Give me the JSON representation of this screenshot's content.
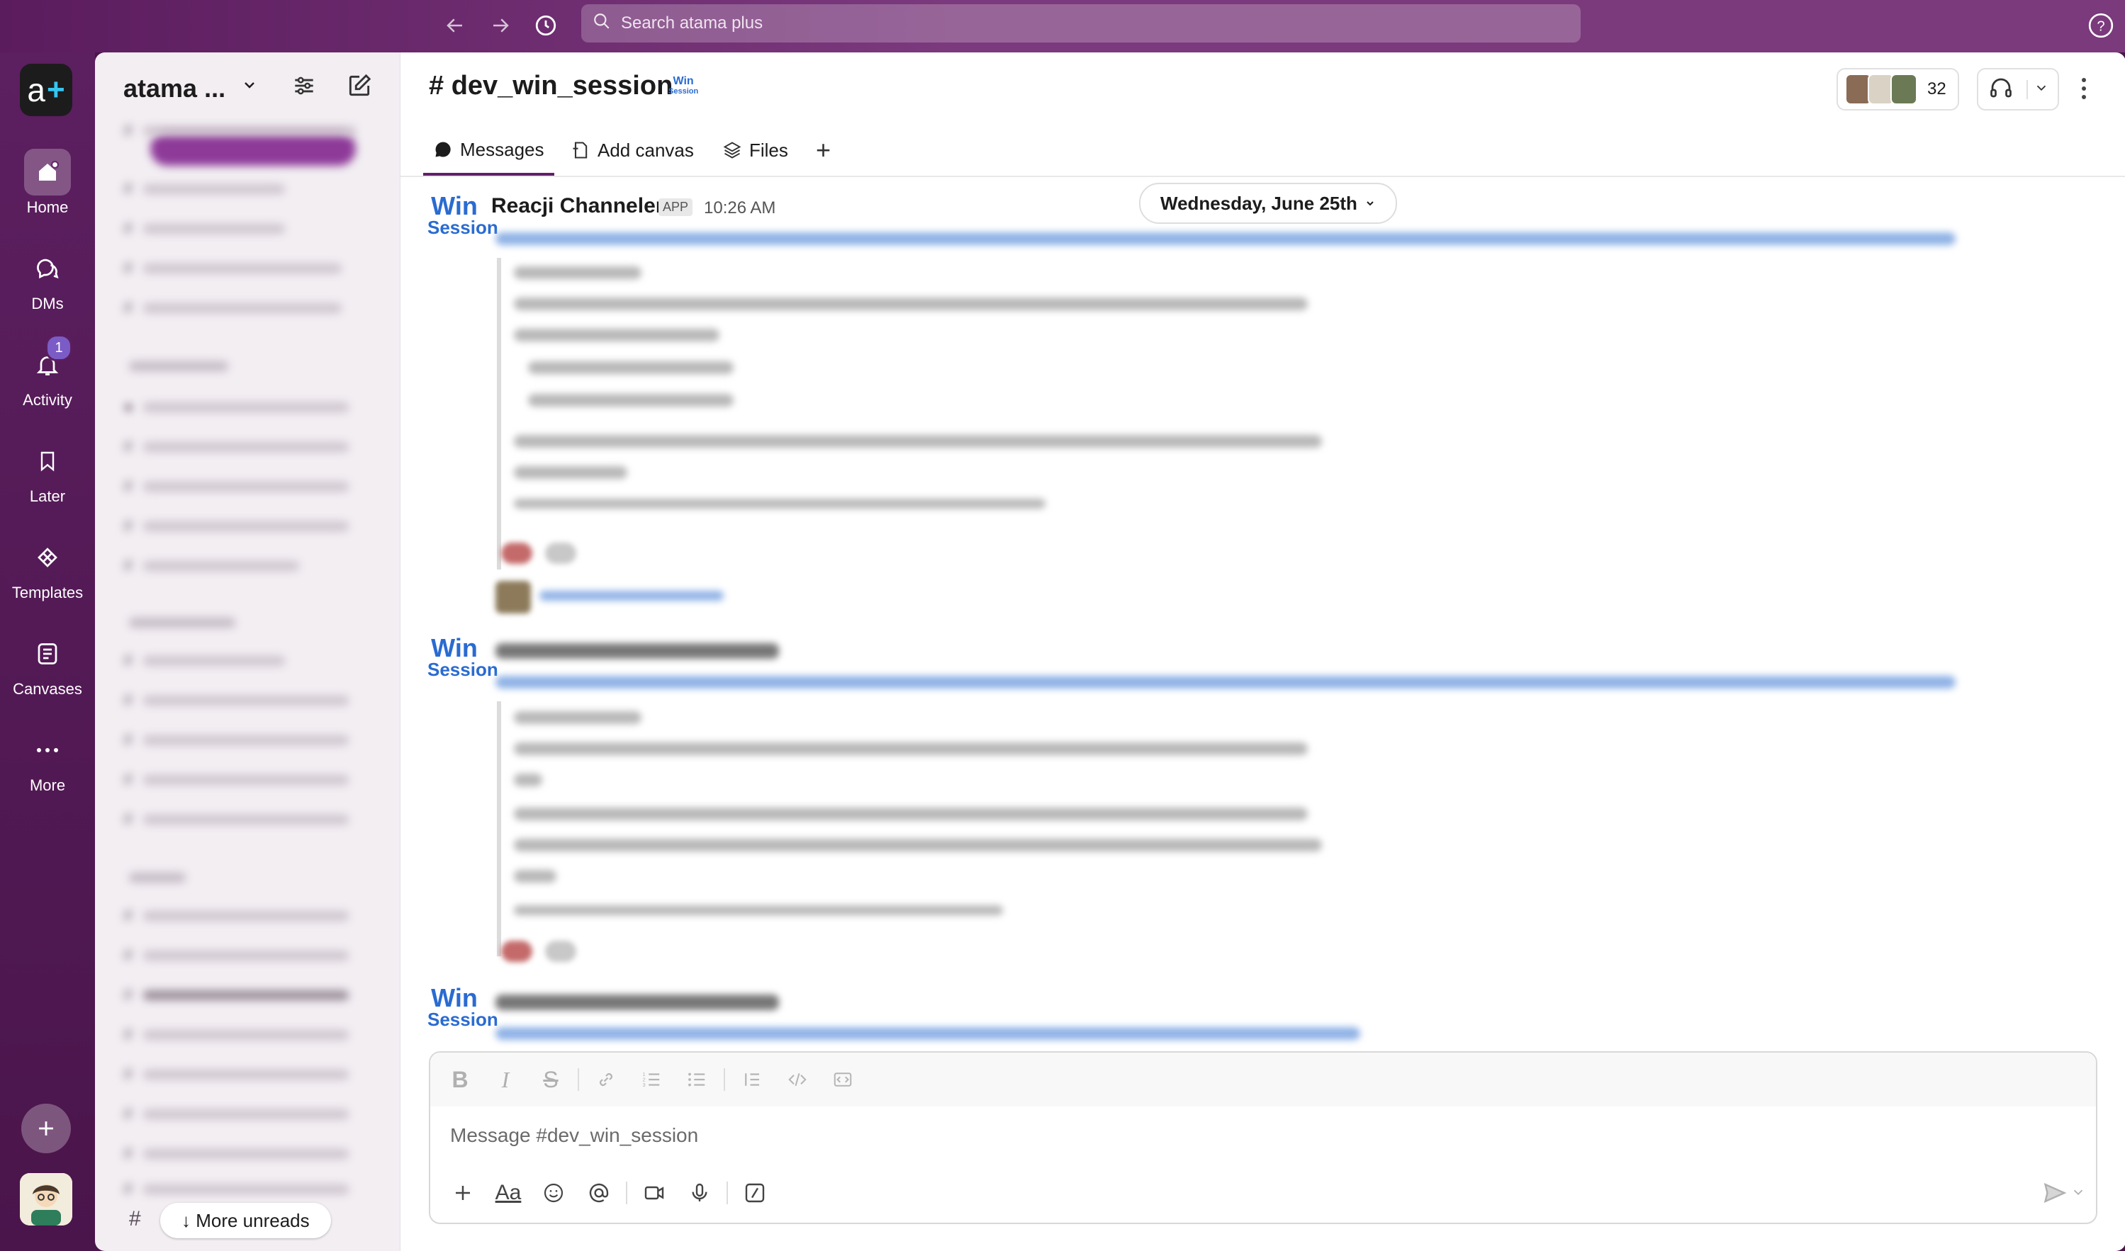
{
  "search": {
    "placeholder": "Search atama plus"
  },
  "rail": {
    "items": [
      {
        "label": "Home",
        "icon": "home-icon"
      },
      {
        "label": "DMs",
        "icon": "dms-icon"
      },
      {
        "label": "Activity",
        "icon": "bell-icon",
        "badge": "1"
      },
      {
        "label": "Later",
        "icon": "bookmark-icon"
      },
      {
        "label": "Templates",
        "icon": "templates-icon"
      },
      {
        "label": "Canvases",
        "icon": "canvas-icon"
      },
      {
        "label": "More",
        "icon": "more-icon"
      }
    ]
  },
  "sidebar": {
    "workspace_name": "atama ...",
    "more_unreads": "↓ More unreads",
    "hash": "#"
  },
  "channel": {
    "title": "# dev_win_session",
    "logo_top": "Win",
    "logo_bottom": "Session",
    "member_count": "32",
    "tabs": {
      "messages": "Messages",
      "add_canvas": "Add canvas",
      "files": "Files",
      "plus": "+"
    }
  },
  "messages": {
    "date_divider": "Wednesday, June 25th",
    "first": {
      "author": "Reacji Channeler",
      "app_badge": "APP",
      "time": "10:26 AM"
    }
  },
  "composer": {
    "placeholder": "Message #dev_win_session"
  },
  "colors": {
    "rail_bg": "#4a154b",
    "accent": "#611f69",
    "link": "#1264a3",
    "badge": "#7b5cc6"
  }
}
